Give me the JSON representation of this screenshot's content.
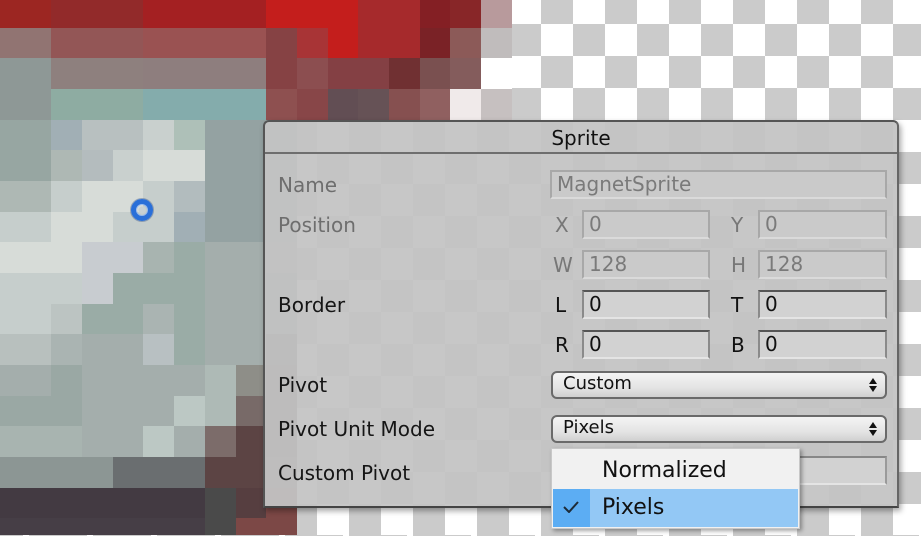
{
  "panel": {
    "title": "Sprite",
    "fields": {
      "name": {
        "label": "Name",
        "value": "MagnetSprite"
      },
      "position": {
        "label": "Position",
        "x": {
          "axis": "X",
          "value": "0"
        },
        "y": {
          "axis": "Y",
          "value": "0"
        },
        "w": {
          "axis": "W",
          "value": "128"
        },
        "h": {
          "axis": "H",
          "value": "128"
        }
      },
      "border": {
        "label": "Border",
        "l": {
          "axis": "L",
          "value": "0"
        },
        "t": {
          "axis": "T",
          "value": "0"
        },
        "r": {
          "axis": "R",
          "value": "0"
        },
        "b": {
          "axis": "B",
          "value": "0"
        }
      },
      "pivot": {
        "label": "Pivot",
        "selected": "Custom"
      },
      "pivot_unit_mode": {
        "label": "Pivot Unit Mode",
        "selected": "Pixels"
      },
      "custom_pivot": {
        "label": "Custom Pivot"
      }
    }
  },
  "pivot_unit_menu": {
    "items": [
      {
        "label": "Normalized",
        "checked": false
      },
      {
        "label": "Pixels",
        "checked": true
      }
    ]
  },
  "colors": {
    "menu_highlight": "#93c8f5",
    "menu_check_cell": "#5cadf3",
    "pivot_handle": "#2a6fd8"
  }
}
